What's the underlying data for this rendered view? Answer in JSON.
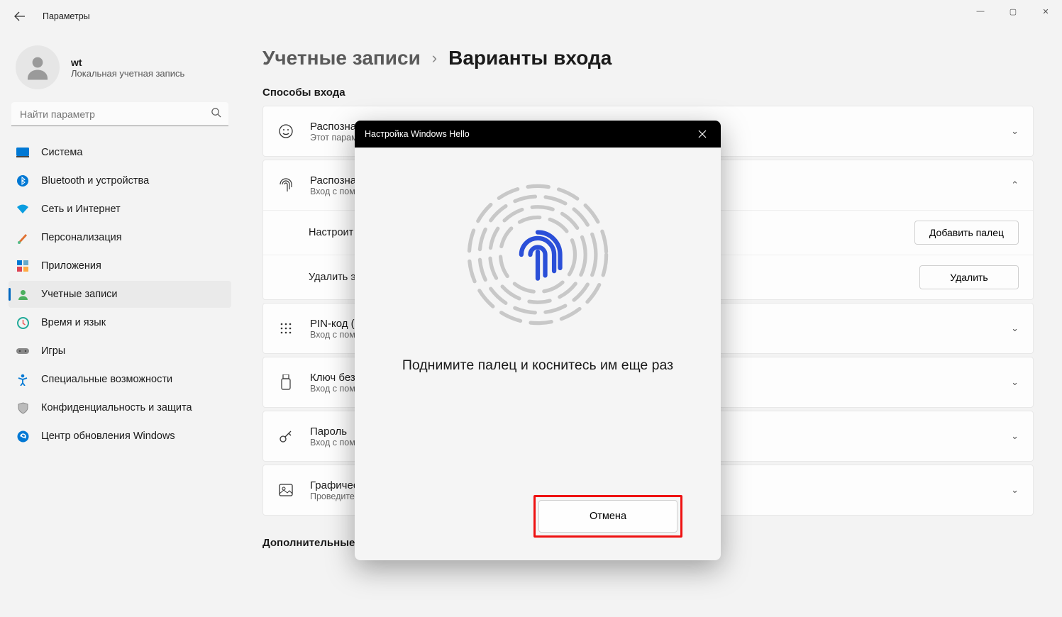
{
  "window": {
    "title": "Параметры",
    "minimize": "—",
    "maximize": "▢",
    "close": "✕"
  },
  "user": {
    "name": "wt",
    "type": "Локальная учетная запись"
  },
  "search": {
    "placeholder": "Найти параметр"
  },
  "nav": {
    "items": [
      "Система",
      "Bluetooth и устройства",
      "Сеть и Интернет",
      "Персонализация",
      "Приложения",
      "Учетные записи",
      "Время и язык",
      "Игры",
      "Специальные возможности",
      "Конфиденциальность и защита",
      "Центр обновления Windows"
    ]
  },
  "breadcrumb": {
    "parent": "Учетные записи",
    "sep": "›",
    "current": "Варианты входа"
  },
  "section": {
    "ways_title": "Способы входа",
    "additional_title": "Дополнительные параметры"
  },
  "cards": {
    "face": {
      "title": "Распозна",
      "sub": "Этот парам"
    },
    "finger": {
      "title": "Распозна",
      "sub": "Вход с пом",
      "row1_label": "Настроит",
      "row1_btn": "Добавить палец",
      "row2_label": "Удалить э",
      "row2_btn": "Удалить"
    },
    "pin": {
      "title": "PIN-код (",
      "sub": "Вход с пом"
    },
    "key": {
      "title": "Ключ без",
      "sub": "Вход с пом"
    },
    "pwd": {
      "title": "Пароль",
      "sub": "Вход с пом"
    },
    "pic": {
      "title": "Графичес",
      "sub": "Проведите"
    }
  },
  "dialog": {
    "title": "Настройка Windows Hello",
    "instruction": "Поднимите палец и коснитесь им еще раз",
    "cancel": "Отмена"
  }
}
